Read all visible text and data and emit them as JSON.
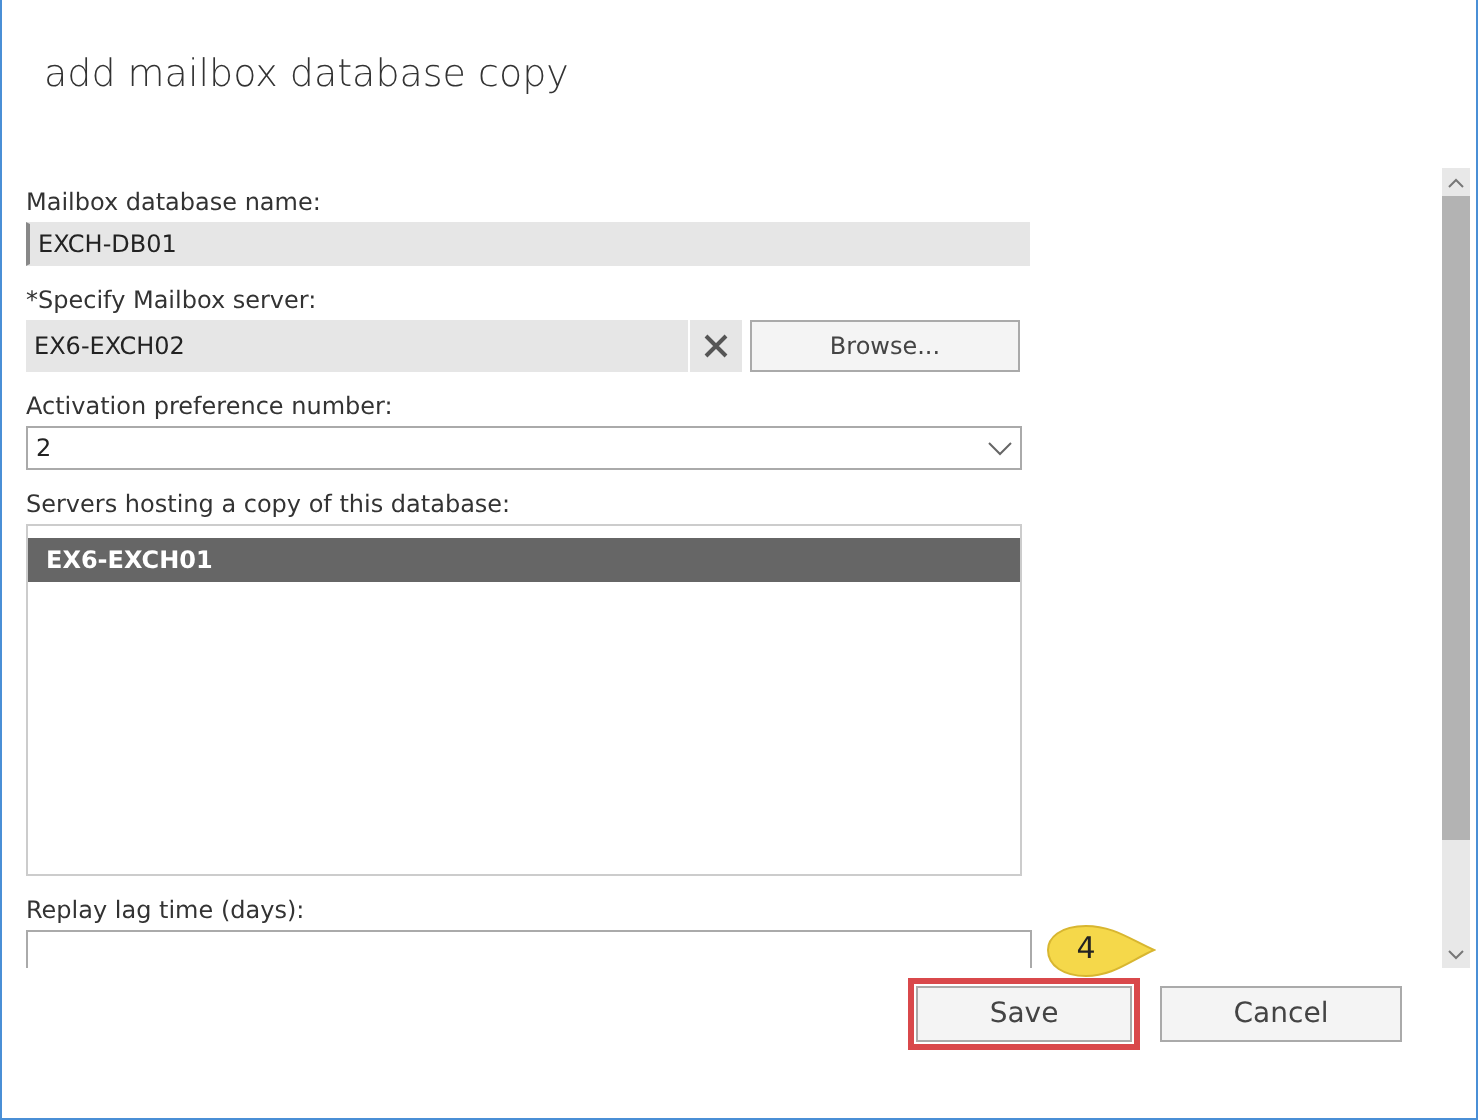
{
  "window": {
    "title": "add mailbox database copy"
  },
  "fields": [
    {
      "kind": "readonly",
      "label": "Mailbox database name:",
      "value": "EXCH-DB01"
    },
    {
      "kind": "picker",
      "label": "*Specify Mailbox server:",
      "value": "EX6-EXCH02",
      "button": "Browse..."
    },
    {
      "kind": "dropdown",
      "label": "Activation preference number:",
      "value": "2"
    },
    {
      "kind": "list",
      "label": "Servers hosting a copy of this database:",
      "items": [
        {
          "text": "EX6-EXCH01",
          "selected": true
        }
      ]
    },
    {
      "kind": "text",
      "label": "Replay lag time (days):"
    }
  ],
  "callout": {
    "text": "4"
  },
  "buttons": [
    {
      "label": "Save",
      "highlighted": true
    },
    {
      "label": "Cancel",
      "highlighted": false
    }
  ]
}
